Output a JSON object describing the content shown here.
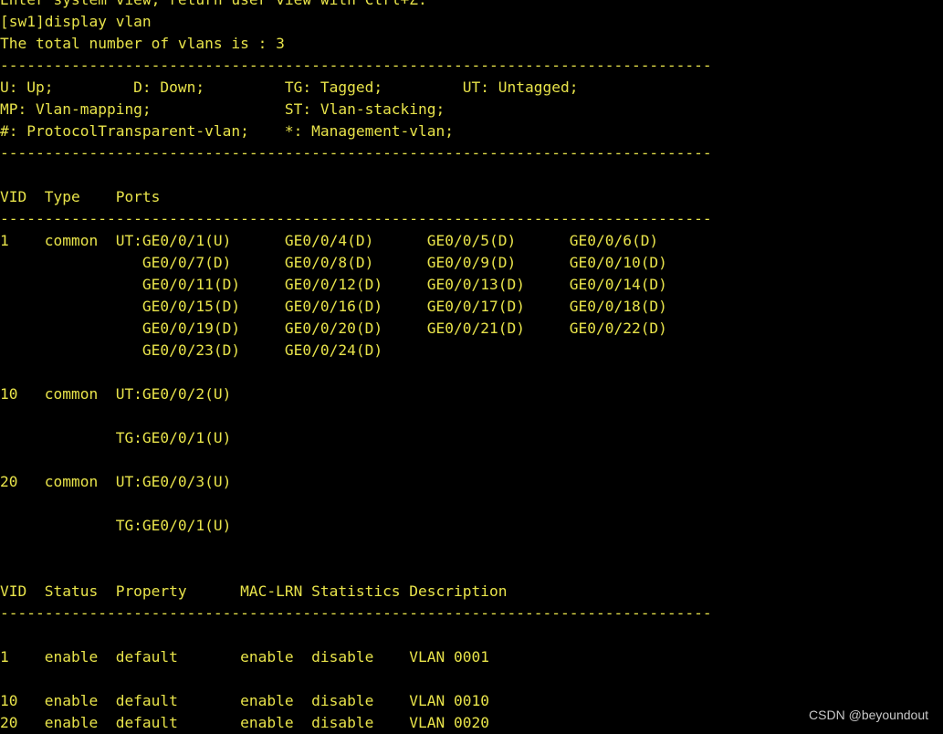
{
  "terminal": {
    "text_color": "#e8e34a",
    "background": "#000000",
    "lines": [
      "Enter system view, return user view with Ctrl+Z.",
      "[sw1]display vlan",
      "The total number of vlans is : 3",
      "--------------------------------------------------------------------------------",
      "U: Up;         D: Down;         TG: Tagged;         UT: Untagged;",
      "MP: Vlan-mapping;               ST: Vlan-stacking;",
      "#: ProtocolTransparent-vlan;    *: Management-vlan;",
      "--------------------------------------------------------------------------------",
      "",
      "VID  Type    Ports",
      "--------------------------------------------------------------------------------",
      "1    common  UT:GE0/0/1(U)      GE0/0/4(D)      GE0/0/5(D)      GE0/0/6(D)",
      "                GE0/0/7(D)      GE0/0/8(D)      GE0/0/9(D)      GE0/0/10(D)",
      "                GE0/0/11(D)     GE0/0/12(D)     GE0/0/13(D)     GE0/0/14(D)",
      "                GE0/0/15(D)     GE0/0/16(D)     GE0/0/17(D)     GE0/0/18(D)",
      "                GE0/0/19(D)     GE0/0/20(D)     GE0/0/21(D)     GE0/0/22(D)",
      "                GE0/0/23(D)     GE0/0/24(D)",
      "",
      "10   common  UT:GE0/0/2(U)",
      "",
      "             TG:GE0/0/1(U)",
      "",
      "20   common  UT:GE0/0/3(U)",
      "",
      "             TG:GE0/0/1(U)",
      "",
      "",
      "VID  Status  Property      MAC-LRN Statistics Description",
      "--------------------------------------------------------------------------------",
      "",
      "1    enable  default       enable  disable    VLAN 0001",
      "",
      "10   enable  default       enable  disable    VLAN 0010",
      "20   enable  default       enable  disable    VLAN 0020"
    ]
  },
  "watermark": "CSDN @beyoundout"
}
